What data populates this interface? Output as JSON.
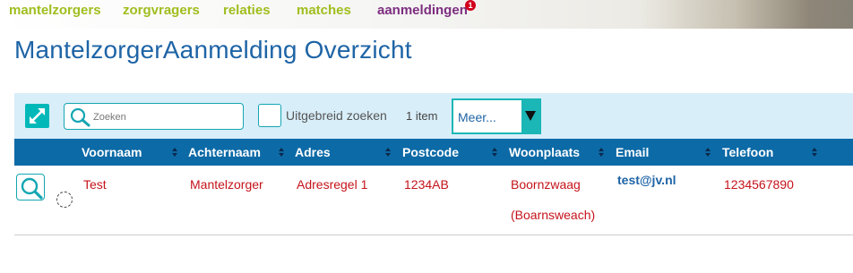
{
  "nav": {
    "items": [
      "mantelzorgers",
      "zorgvragers",
      "relaties",
      "matches",
      "aanmeldingen"
    ],
    "badge": "1"
  },
  "page_title": "MantelzorgerAanmelding Overzicht",
  "toolbar": {
    "search_placeholder": "Zoeken",
    "advanced_label": "Uitgebreid zoeken",
    "count_label": "1 item",
    "more_label": "Meer..."
  },
  "table": {
    "columns": [
      "Voornaam",
      "Achternaam",
      "Adres",
      "Postcode",
      "Woonplaats",
      "Email",
      "Telefoon"
    ],
    "rows": [
      {
        "voornaam": "Test",
        "achternaam": "Mantelzorger",
        "adres": "Adresregel 1",
        "postcode": "1234AB",
        "woonplaats": "Boornzwaag",
        "woonplaats_alt": "(Boarnsweach)",
        "email": "test@jv.nl",
        "telefoon": "1234567890"
      }
    ]
  },
  "colors": {
    "nav_green": "#9fbe1e",
    "nav_active": "#7d2e80",
    "title_blue": "#1e64a6",
    "header_blue": "#0c6aa7",
    "toolbar_bg": "#d8eef9",
    "teal": "#00b8b8",
    "row_red": "#c5131b"
  },
  "icons": [
    "expand-icon",
    "search-icon",
    "magnifier-icon",
    "dropdown-arrow-icon",
    "sort-icon",
    "status-circle-icon"
  ]
}
